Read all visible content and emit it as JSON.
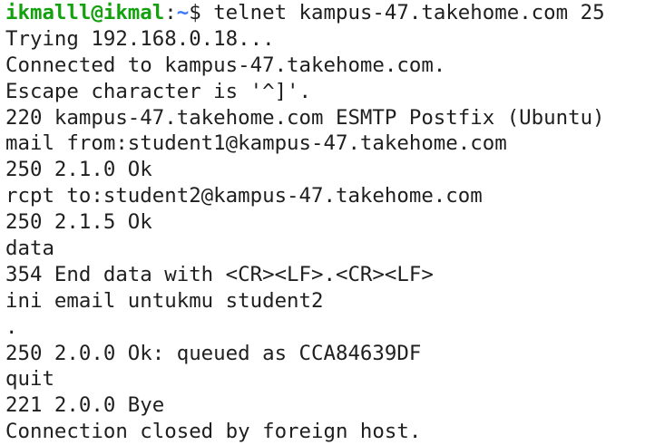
{
  "prompt": {
    "user_host": "ikmalll@ikmal",
    "separator": ":",
    "path": "~",
    "symbol": "$ ",
    "command": "telnet kampus-47.takehome.com 25"
  },
  "output_lines": [
    "Trying 192.168.0.18...",
    "Connected to kampus-47.takehome.com.",
    "Escape character is '^]'.",
    "220 kampus-47.takehome.com ESMTP Postfix (Ubuntu)",
    "mail from:student1@kampus-47.takehome.com",
    "250 2.1.0 Ok",
    "rcpt to:student2@kampus-47.takehome.com",
    "250 2.1.5 Ok",
    "data",
    "354 End data with <CR><LF>.<CR><LF>",
    "ini email untukmu student2",
    ".",
    "250 2.0.0 Ok: queued as CCA84639DF",
    "quit",
    "221 2.0.0 Bye",
    "Connection closed by foreign host."
  ],
  "colors": {
    "background": "#ffffff",
    "text": "#1f1f1f",
    "user_host": "#13a10e",
    "path": "#3b78ff"
  }
}
